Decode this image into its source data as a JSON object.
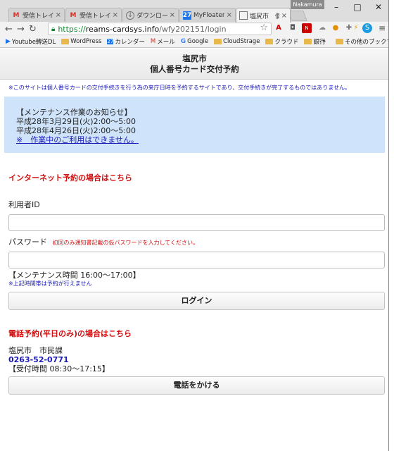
{
  "browser": {
    "tabs": [
      {
        "title": "受信トレイ - k",
        "favicon": "gmail-icon"
      },
      {
        "title": "受信トレイ - k",
        "favicon": "gmail-icon"
      },
      {
        "title": "ダウンロード記",
        "favicon": "download-icon"
      },
      {
        "title": "MyFloater -",
        "favicon": "calendar-icon"
      },
      {
        "title": "塩尻市　個",
        "favicon": "document-icon"
      }
    ],
    "user_name": "Nakamura",
    "url": {
      "scheme": "https://",
      "host": "reams-cardsys.info",
      "path": "/wfy202151/login"
    },
    "bookmarks": [
      {
        "label": "Youtube轉送DL",
        "icon": "chrome-app-icon"
      },
      {
        "label": "WordPress",
        "icon": "folder-icon"
      },
      {
        "label": "カレンダー",
        "icon": "calendar-icon"
      },
      {
        "label": "メール",
        "icon": "gmail-icon"
      },
      {
        "label": "Google",
        "icon": "google-icon"
      },
      {
        "label": "CloudStrage",
        "icon": "folder-icon"
      },
      {
        "label": "クラウド",
        "icon": "folder-icon"
      },
      {
        "label": "銀行",
        "icon": "folder-icon"
      }
    ],
    "bookmarks_more": "»",
    "other_bookmarks": "その他のブックマーク"
  },
  "page": {
    "header_line1": "塩尻市",
    "header_line2": "個人番号カード交付予約",
    "notice": "※このサイトは個人番号カードの交付手続きを行う為の来庁日時を予約するサイトであり、交付手続きが完了するものではありません。",
    "maintenance": {
      "title": "【メンテナンス作業のお知らせ】",
      "line1": "平成28年3月29日(火)2:00～5:00",
      "line2": "平成28年4月26日(火)2:00～5:00",
      "link": "※　作業中のご利用はできません。"
    },
    "internet_section": "インターネット予約の場合はこちら",
    "user_id_label": "利用者ID",
    "password_label": "パスワード",
    "password_hint": "初回のみ通知書記載の仮パスワードを入力してください。",
    "maint_time": "【メンテナンス時間 16:00～17:00】",
    "maint_note": "※上記時間帯は予約が行えません",
    "login_button": "ログイン",
    "phone_section": "電話予約(平日のみ)の場合はこちら",
    "office": "塩尻市　市民課",
    "phone": "0263-52-0771",
    "hours": "【受付時間 08:30～17:15】",
    "call_button": "電話をかける"
  }
}
